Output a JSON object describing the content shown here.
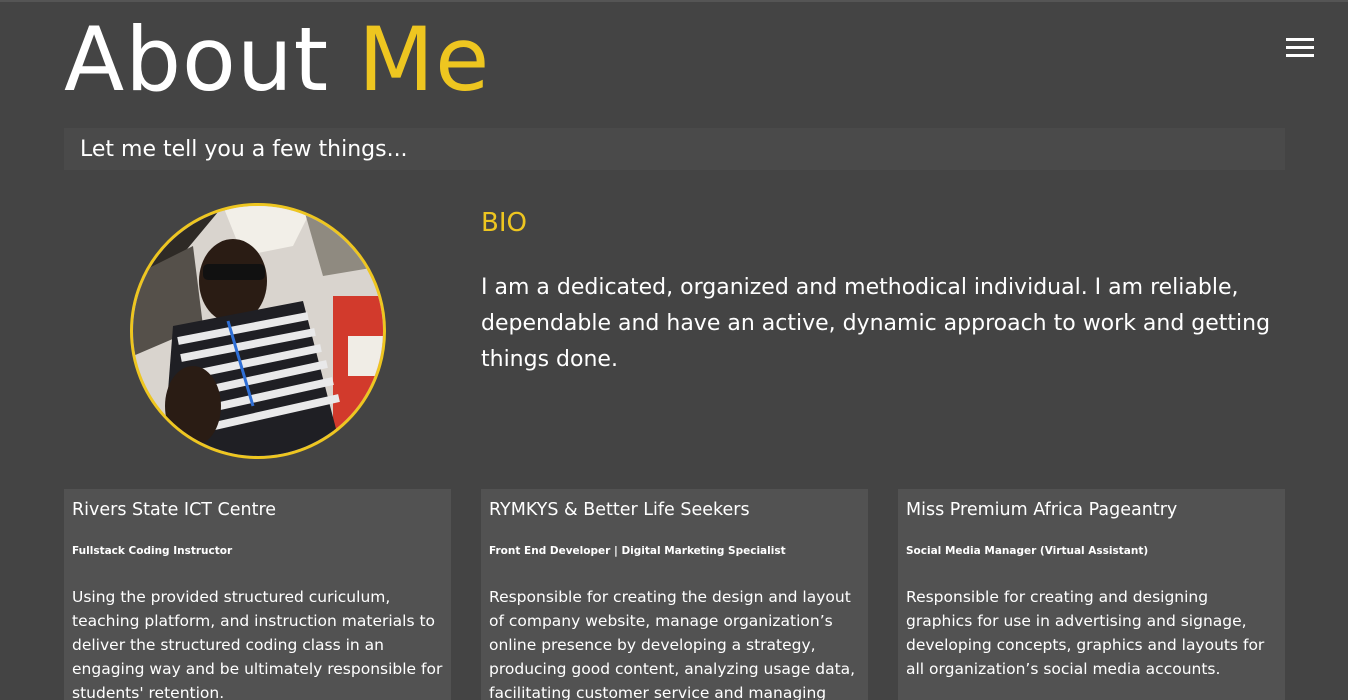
{
  "header": {
    "title_main": "About",
    "title_accent": "Me",
    "subtitle": "Let me tell you a few things..."
  },
  "menu": {
    "icon": "hamburger-menu-icon"
  },
  "colors": {
    "background": "#444444",
    "accent": "#eec620",
    "card": "#525252"
  },
  "bio": {
    "heading": "BIO",
    "text": "I am a dedicated, organized and methodical individual. I am reliable, dependable and have an active, dynamic approach to work and getting things done."
  },
  "experience": [
    {
      "company": "Rivers State ICT Centre",
      "role": "Fullstack Coding Instructor",
      "description": "Using the provided structured curiculum, teaching platform, and instruction materials to deliver the structured coding class in an engaging way and be ultimately responsible for students' retention."
    },
    {
      "company": "RYMKYS & Better Life Seekers",
      "role": "Front End Developer | Digital Marketing Specialist",
      "description": "Responsible for creating the design and layout of company website, manage organization’s online presence by developing a strategy, producing good content, analyzing usage data, facilitating customer service and managing projects and campaigns."
    },
    {
      "company": "Miss Premium Africa Pageantry",
      "role": "Social Media Manager (Virtual Assistant)",
      "description": "Responsible for creating and designing graphics for use in advertising and signage, developing concepts, graphics and layouts for all organization’s social media accounts."
    }
  ]
}
